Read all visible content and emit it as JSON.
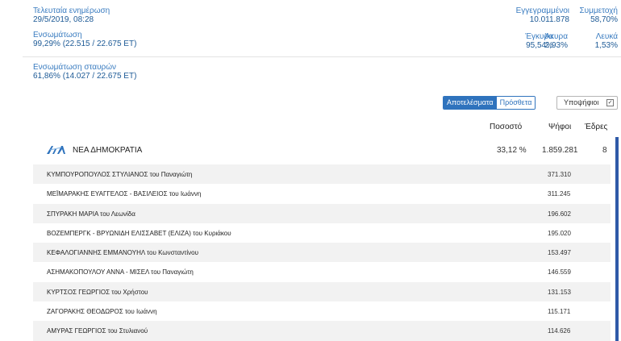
{
  "info": {
    "last_update_label": "Τελευταία ενημέρωση",
    "last_update_value": "29/5/2019, 08:28",
    "integration_label": "Ενσωμάτωση",
    "integration_value": "99,29% (22.515 / 22.675 ΕΤ)",
    "cross_label": "Ενσωμάτωση σταυρών",
    "cross_value": "61,86% (14.027 / 22.675 ΕΤ)"
  },
  "stats": {
    "registered_label": "Εγγεγραμμένοι",
    "registered_value": "10.011.878",
    "turnout_label": "Συμμετοχή",
    "turnout_value": "58,70%",
    "valid_label": "Έγκυρα",
    "valid_value": "95,54%",
    "invalid_label": "Άκυρα",
    "invalid_value": "2,93%",
    "blank_label": "Λευκά",
    "blank_value": "1,53%"
  },
  "toolbar": {
    "results_tab": "Αποτελέσματα",
    "more_tab": "Πρόσθετα",
    "candidates_label": "Υποψήφιοι",
    "candidates_checked": "☑"
  },
  "table_headers": {
    "percent": "Ποσοστό",
    "votes": "Ψήφοι",
    "seats": "Έδρες"
  },
  "party": {
    "logo_text": "ΝΔ",
    "name": "ΝΕΑ ΔΗΜΟΚΡΑΤΙΑ",
    "percent": "33,12 %",
    "votes": "1.859.281",
    "seats": "8"
  },
  "candidates": [
    {
      "name": "ΚΥΜΠΟΥΡΟΠΟΥΛΟΣ ΣΤΥΛΙΑΝΟΣ του Παναγιώτη",
      "votes": "371.310"
    },
    {
      "name": "ΜΕΪΜΑΡΑΚΗΣ ΕΥΑΓΓΕΛΟΣ - ΒΑΣΙΛΕΙΟΣ του Ιωάννη",
      "votes": "311.245"
    },
    {
      "name": "ΣΠΥΡΑΚΗ ΜΑΡΙΑ του Λεωνίδα",
      "votes": "196.602"
    },
    {
      "name": "ΒΟΖΕΜΠΕΡΓΚ - ΒΡΥΩΝΙΔΗ ΕΛΙΣΣΑΒΕΤ (ΕΛΙΖΑ) του Κυριάκου",
      "votes": "195.020"
    },
    {
      "name": "ΚΕΦΑΛΟΓΙΑΝΝΗΣ ΕΜΜΑΝΟΥΗΛ του Κωνσταντίνου",
      "votes": "153.497"
    },
    {
      "name": "ΑΣΗΜΑΚΟΠΟΥΛΟΥ ΑΝΝΑ - ΜΙΣΕΛ του Παναγιώτη",
      "votes": "146.559"
    },
    {
      "name": "ΚΥΡΤΣΟΣ ΓΕΩΡΓΙΟΣ του Χρήστου",
      "votes": "131.153"
    },
    {
      "name": "ΖΑΓΟΡΑΚΗΣ ΘΕΟΔΩΡΟΣ του Ιωάννη",
      "votes": "115.171"
    },
    {
      "name": "ΑΜΥΡΑΣ ΓΕΩΡΓΙΟΣ του Στυλιανού",
      "votes": "114.626"
    }
  ],
  "colors": {
    "accent": "#2f73bd",
    "label_blue": "#3a7cc0",
    "party_bar": "#2f5aa8"
  }
}
